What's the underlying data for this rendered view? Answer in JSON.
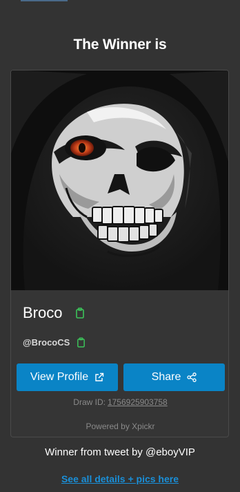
{
  "heading": "The Winner is",
  "winner": {
    "name": "Broco",
    "handle": "@BrocoCS",
    "avatar_icon": "grim-reaper-skull-avatar"
  },
  "buttons": {
    "view_profile": "View Profile",
    "view_profile_icon": "external-link-icon",
    "share": "Share",
    "share_icon": "share-icon"
  },
  "draw": {
    "label": "Draw ID:",
    "id": "1756925903758"
  },
  "powered_by": "Powered by Xpickr",
  "tweet_line": "Winner from tweet by @eboyVIP",
  "details_link": "See all details + pics here",
  "colors": {
    "background": "#333333",
    "button": "#0a84c6",
    "copy_icon": "#3cc45a",
    "link": "#1a8fd8"
  }
}
